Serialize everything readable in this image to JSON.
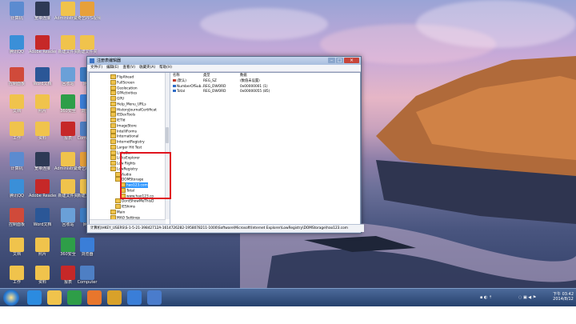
{
  "desktop": {
    "icons": [
      {
        "label": "计算机",
        "color": "#5b8bd0"
      },
      {
        "label": "宽带连接",
        "color": "#2e3a55"
      },
      {
        "label": "Administrator",
        "color": "#f0c34c"
      },
      {
        "label": "爱奇艺PPS视频",
        "color": "#e7a03a"
      },
      {
        "label": "腾讯QQ",
        "color": "#3a8fd8"
      },
      {
        "label": "Adobe Reader",
        "color": "#c62828"
      },
      {
        "label": "新建文件夹",
        "color": "#f0c34c"
      },
      {
        "label": "新建文件夹",
        "color": "#f0c34c"
      },
      {
        "label": "控制面板",
        "color": "#d04a3a"
      },
      {
        "label": "Word文档",
        "color": "#2b5797"
      },
      {
        "label": "回收站",
        "color": "#6aa0d8"
      },
      {
        "label": "网络",
        "color": "#3c7dc4"
      },
      {
        "label": "文档",
        "color": "#f0c34c"
      },
      {
        "label": "照片",
        "color": "#f0c34c"
      },
      {
        "label": "360安全",
        "color": "#2e9e48"
      },
      {
        "label": "浏览器",
        "color": "#3a7ed8"
      },
      {
        "label": "工作",
        "color": "#f0c34c"
      },
      {
        "label": "资料",
        "color": "#f0c34c"
      },
      {
        "label": "报表",
        "color": "#c62828"
      },
      {
        "label": "Computer",
        "color": "#4e7fc4"
      }
    ]
  },
  "regedit": {
    "title": "注册表编辑器",
    "menu": [
      "文件(F)",
      "编辑(E)",
      "查看(V)",
      "收藏夹(A)",
      "帮助(H)"
    ],
    "tree": [
      {
        "label": "FlipAhead",
        "indent": 0
      },
      {
        "label": "FullScreen",
        "indent": 0
      },
      {
        "label": "Geolocation",
        "indent": 0
      },
      {
        "label": "GPActivities",
        "indent": 0
      },
      {
        "label": "GPU",
        "indent": 0
      },
      {
        "label": "Help_Menu_URLs",
        "indent": 0
      },
      {
        "label": "HistoryJournalCertificat",
        "indent": 0
      },
      {
        "label": "IEDevTools",
        "indent": 0
      },
      {
        "label": "IETld",
        "indent": 0
      },
      {
        "label": "ImageStore",
        "indent": 0
      },
      {
        "label": "IntelliForms",
        "indent": 0
      },
      {
        "label": "International",
        "indent": 0
      },
      {
        "label": "InternetRegistry",
        "indent": 0
      },
      {
        "label": "Larger Hit Test",
        "indent": 0
      },
      {
        "label": "LinksBar",
        "indent": 0
      },
      {
        "label": "LinksExplorer",
        "indent": 0
      },
      {
        "label": "Low Rights",
        "indent": 0
      },
      {
        "label": "LowRegistry",
        "indent": 0
      },
      {
        "label": "Audio",
        "indent": 1
      },
      {
        "label": "DOMStorage",
        "indent": 1
      },
      {
        "label": "hao123.com",
        "indent": 2,
        "selected": true
      },
      {
        "label": "Total",
        "indent": 2
      },
      {
        "label": "www.hao123.co",
        "indent": 2
      },
      {
        "label": "DontShowMeThisD",
        "indent": 1
      },
      {
        "label": "IEShims",
        "indent": 1
      },
      {
        "label": "Main",
        "indent": 0
      },
      {
        "label": "MAO Settings",
        "indent": 0
      }
    ],
    "columns": {
      "name": "名称",
      "type": "类型",
      "data": "数据"
    },
    "values": [
      {
        "name": "(默认)",
        "type": "REG_SZ",
        "data": "(数值未设置)",
        "icon": "#c0392b"
      },
      {
        "name": "NumberOfSub...",
        "type": "REG_DWORD",
        "data": "0x00000001 (1)",
        "icon": "#2e6bc6"
      },
      {
        "name": "Total",
        "type": "REG_DWORD",
        "data": "0x00000055 (85)",
        "icon": "#2e6bc6"
      }
    ],
    "statusbar": "计算机\\HKEY_USERS\\S-1-5-21-39842712A-1614726282-1958078211-1000\\Software\\Microsoft\\Internet Explorer\\LowRegistry\\DOMStorage\\hao123.com"
  },
  "taskbar": {
    "apps": [
      {
        "name": "ie-icon",
        "color": "#2b8be0"
      },
      {
        "name": "explorer-icon",
        "color": "#f0c34c"
      },
      {
        "name": "360-icon",
        "color": "#2e9e48"
      },
      {
        "name": "media-player-icon",
        "color": "#e8762c"
      },
      {
        "name": "chrome-icon",
        "color": "#d8a12a"
      },
      {
        "name": "ie-icon-2",
        "color": "#3a7ed8"
      },
      {
        "name": "regedit-icon",
        "color": "#4a7ccc"
      }
    ],
    "time": "下午 03:42",
    "date": "2014/8/12"
  }
}
